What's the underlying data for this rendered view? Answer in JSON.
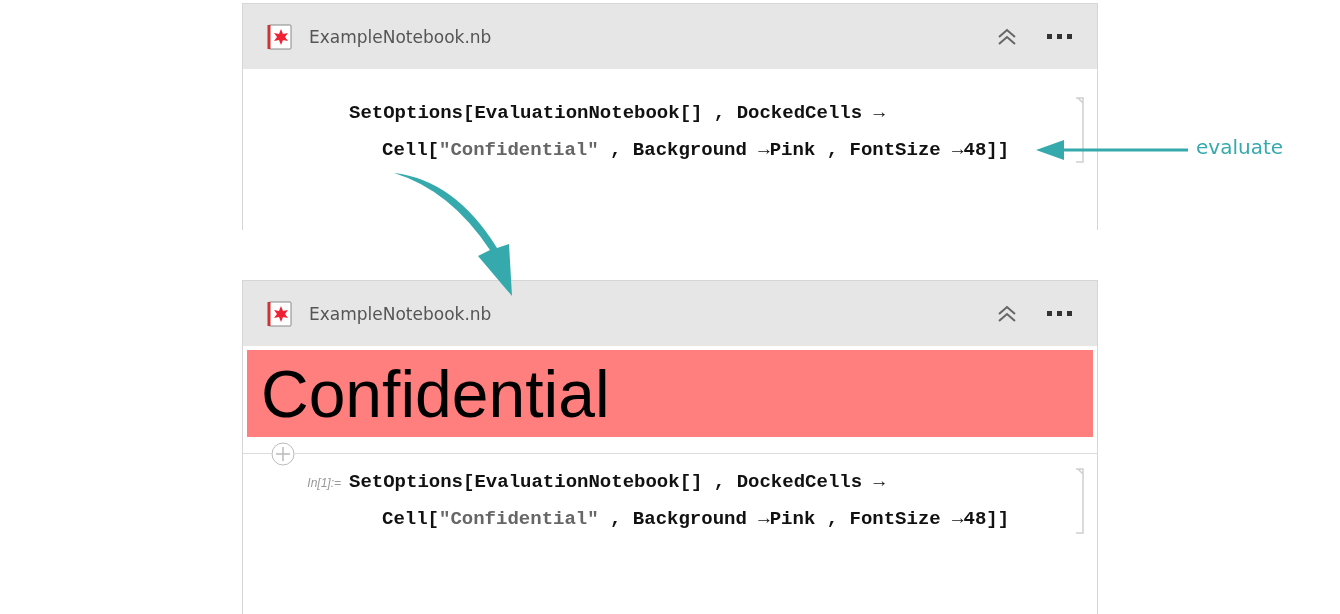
{
  "notebooks": [
    {
      "title": "ExampleNotebook.nb",
      "cells": [
        {
          "lines": [
            [
              {
                "kind": "code",
                "text": "SetOptions[EvaluationNotebook[] , DockedCells →"
              }
            ],
            [
              {
                "kind": "code",
                "text": "Cell["
              },
              {
                "kind": "string",
                "text": "\"Confidential\""
              },
              {
                "kind": "code",
                "text": " , Background →Pink , FontSize →48]]"
              }
            ]
          ]
        }
      ]
    },
    {
      "title": "ExampleNotebook.nb",
      "docked_cell": {
        "text": "Confidential"
      },
      "cells": [
        {
          "label": "In[1]:=",
          "lines": [
            [
              {
                "kind": "code",
                "text": "SetOptions[EvaluationNotebook[] , DockedCells →"
              }
            ],
            [
              {
                "kind": "code",
                "text": "Cell["
              },
              {
                "kind": "string",
                "text": "\"Confidential\""
              },
              {
                "kind": "code",
                "text": " , Background →Pink , FontSize →48]]"
              }
            ]
          ]
        }
      ]
    }
  ],
  "annotation": {
    "label": "evaluate"
  }
}
